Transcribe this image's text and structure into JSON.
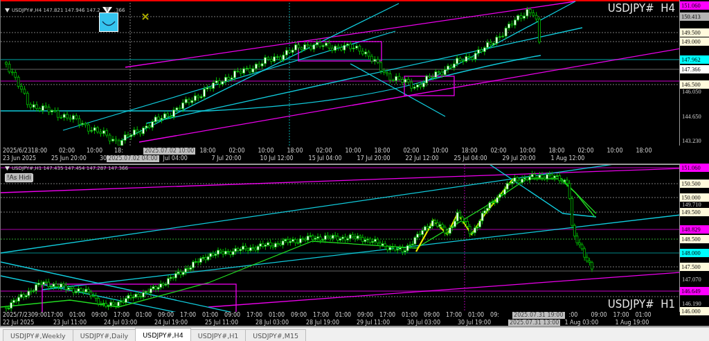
{
  "panes": [
    {
      "header": "USDJPY#,H4  147.821 147.946 147.2",
      "header_tail": ".366",
      "symbol": "USDJPY#  H4",
      "price_labels": [
        {
          "kind": "tag",
          "text": "151.060",
          "color": "#ff00ff"
        },
        {
          "kind": "tag",
          "text": "150.413",
          "color": "#b4b4b4"
        },
        {
          "kind": "tag",
          "text": "149.500",
          "color": "#fffadc"
        },
        {
          "kind": "tag",
          "text": "149.000",
          "color": "#fffadc"
        },
        {
          "kind": "tag",
          "text": "147.962",
          "color": "#00ffff"
        },
        {
          "kind": "tag",
          "text": "147.366",
          "color": "#ffffff"
        },
        {
          "kind": "tag",
          "text": "146.500",
          "color": "#fffadc"
        },
        {
          "kind": "tick",
          "text": "146.050"
        },
        {
          "kind": "tick",
          "text": "144.650"
        },
        {
          "kind": "tick",
          "text": "143.230"
        }
      ],
      "time_upper": [
        "2025/6/23",
        "18:00",
        "02:00",
        "10:00",
        "18:",
        "2025.07.02 10:00",
        "18:00",
        "02:00",
        "10:00",
        "18:00",
        "02:00",
        "10:00",
        "18:00",
        "02:00",
        "10:00",
        "18:00",
        "02:00",
        "10:00",
        "18:00",
        "02:00",
        "10:00",
        "18:00"
      ],
      "time_lower": [
        "23 Jun 2025",
        "25 Jun 20:00",
        "30",
        "2025.07.02 04:00",
        "Jul 04:00",
        "7 Jul 20:00",
        "10 Jul 12:00",
        "15 Jul 04:00",
        "17 Jul 20:00",
        "22 Jul 12:00",
        "25 Jul 04:00",
        "29 Jul 20:00",
        "1 Aug 12:00"
      ]
    },
    {
      "header": "USDJPY#,H1  147.435 147.454 147.287 147.366",
      "symbol": "USDJPY#  H1",
      "button": "!As Hidi",
      "price_labels": [
        {
          "kind": "tag",
          "text": "151.060",
          "color": "#ff00ff"
        },
        {
          "kind": "tag",
          "text": "150.500",
          "color": "#fffadc"
        },
        {
          "kind": "tag",
          "text": "150.000",
          "color": "#fffadc"
        },
        {
          "kind": "tick",
          "text": "149.710"
        },
        {
          "kind": "tag",
          "text": "149.500",
          "color": "#fffadc"
        },
        {
          "kind": "tag",
          "text": "148.829",
          "color": "#ff00ff"
        },
        {
          "kind": "tag",
          "text": "148.500",
          "color": "#fffadc"
        },
        {
          "kind": "tag",
          "text": "148.000",
          "color": "#00ffff"
        },
        {
          "kind": "tag",
          "text": "147.500",
          "color": "#fffadc"
        },
        {
          "kind": "tick",
          "text": "147.070"
        },
        {
          "kind": "tag",
          "text": "146.649",
          "color": "#ff00ff"
        },
        {
          "kind": "tick",
          "text": "146.190"
        },
        {
          "kind": "tag",
          "text": "146.000",
          "color": "#fffadc"
        }
      ],
      "time_upper": [
        "2025/7/23",
        "09:00",
        "17:00",
        "01:00",
        "09:00",
        "17:00",
        "01:00",
        "09:00",
        "17:00",
        "01:00",
        "09:00",
        "17:00",
        "01:00",
        "09:00",
        "17:00",
        "01:00",
        "09:00",
        "17:00",
        "01:00",
        "09:00",
        "17:00",
        "01:00",
        "09:",
        "2025.07.31 19:00",
        ":00",
        "09:00",
        "17:00",
        "01:00"
      ],
      "time_lower": [
        "22 Jul 2025",
        "23 Jul 11:00",
        "24 Jul 03:00",
        "24 Jul 19:00",
        "25 Jul 11:00",
        "28 Jul 03:00",
        "28 Jul 19:00",
        "29 Jul 11:00",
        "30 Jul 03:00",
        "30 Jul 19:00",
        "2025.07.31 13:00",
        "1 Aug 03:00",
        "1 Aug 19:00"
      ]
    }
  ],
  "tabs": [
    {
      "label": "USDJPY#,Weekly",
      "selected": false
    },
    {
      "label": "USDJPY#,Daily",
      "selected": false
    },
    {
      "label": "USDJPY#,H4",
      "selected": true
    },
    {
      "label": "USDJPY#,H1",
      "selected": false
    },
    {
      "label": "USDJPY#,M15",
      "selected": false
    }
  ]
}
